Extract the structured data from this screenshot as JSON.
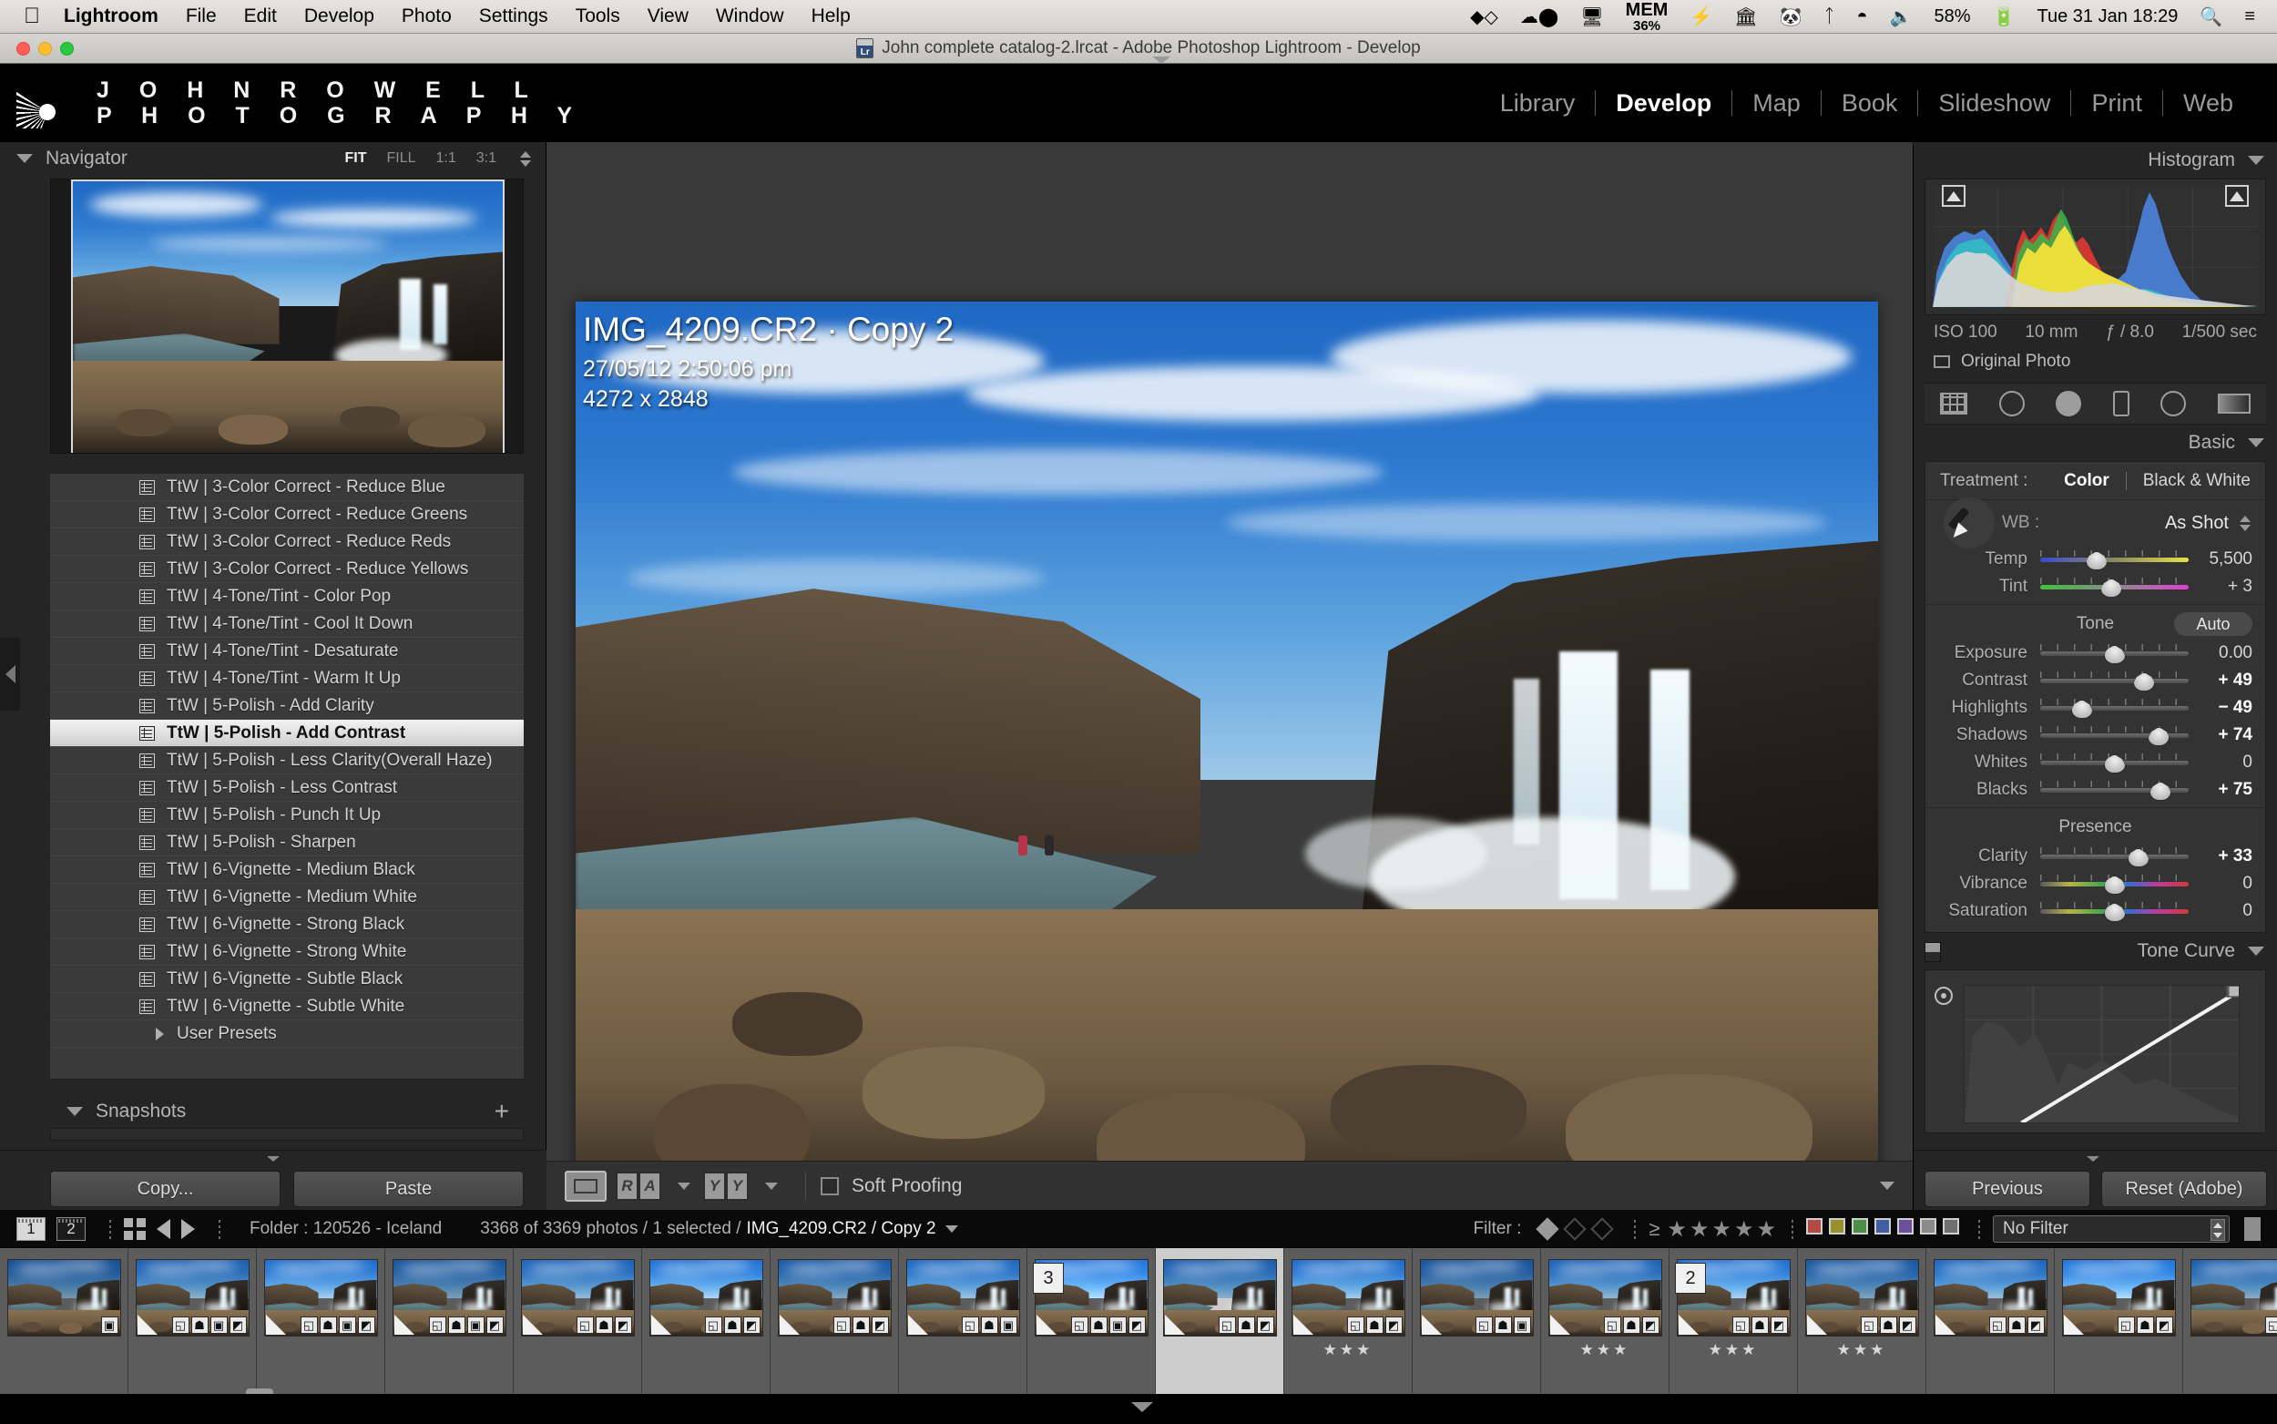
{
  "menubar": {
    "apple_icon": "apple-logo",
    "items": [
      "Lightroom",
      "File",
      "Edit",
      "Develop",
      "Photo",
      "Settings",
      "Tools",
      "View",
      "Window",
      "Help"
    ],
    "status_icons": [
      "dropbox-icon",
      "cloud-record-icon",
      "airplay-icon"
    ],
    "memory_label": "MEM",
    "memory_value": "36%",
    "more_icons": [
      "bolt-icon",
      "bank-icon",
      "evernote-icon",
      "bluetooth-icon",
      "wifi-icon",
      "volume-icon"
    ],
    "battery_percent": "58%",
    "clock": "Tue 31 Jan  18:29",
    "search_icon": "search-icon",
    "notification_icon": "notification-list-icon"
  },
  "titlebar": {
    "title": "John complete catalog-2.lrcat - Adobe Photoshop Lightroom - Develop",
    "app_badge": "Lr"
  },
  "identity": {
    "line1": "J O H N   R O W E L L",
    "line2": "P H O T O G R A P H Y",
    "logo_icon": "sunburst-logo-icon"
  },
  "modules": {
    "items": [
      "Library",
      "Develop",
      "Map",
      "Book",
      "Slideshow",
      "Print",
      "Web"
    ],
    "active": "Develop"
  },
  "left_panel": {
    "navigator": {
      "title": "Navigator",
      "zoom_options": [
        "FIT",
        "FILL",
        "1:1",
        "3:1"
      ],
      "active_zoom": "FIT"
    },
    "presets": [
      {
        "label": "TtW | 3-Color Correct - Reduce Blue",
        "selected": false
      },
      {
        "label": "TtW | 3-Color Correct - Reduce Greens",
        "selected": false
      },
      {
        "label": "TtW | 3-Color Correct - Reduce Reds",
        "selected": false
      },
      {
        "label": "TtW | 3-Color Correct - Reduce Yellows",
        "selected": false
      },
      {
        "label": "TtW | 4-Tone/Tint - Color Pop",
        "selected": false
      },
      {
        "label": "TtW | 4-Tone/Tint - Cool It Down",
        "selected": false
      },
      {
        "label": "TtW | 4-Tone/Tint - Desaturate",
        "selected": false
      },
      {
        "label": "TtW | 4-Tone/Tint - Warm It Up",
        "selected": false
      },
      {
        "label": "TtW | 5-Polish - Add Clarity",
        "selected": false
      },
      {
        "label": "TtW | 5-Polish - Add Contrast",
        "selected": true
      },
      {
        "label": "TtW | 5-Polish - Less Clarity(Overall Haze)",
        "selected": false
      },
      {
        "label": "TtW | 5-Polish - Less Contrast",
        "selected": false
      },
      {
        "label": "TtW | 5-Polish - Punch It Up",
        "selected": false
      },
      {
        "label": "TtW | 5-Polish - Sharpen",
        "selected": false
      },
      {
        "label": "TtW | 6-Vignette - Medium Black",
        "selected": false
      },
      {
        "label": "TtW | 6-Vignette - Medium White",
        "selected": false
      },
      {
        "label": "TtW | 6-Vignette - Strong Black",
        "selected": false
      },
      {
        "label": "TtW | 6-Vignette - Strong White",
        "selected": false
      },
      {
        "label": "TtW | 6-Vignette - Subtle Black",
        "selected": false
      },
      {
        "label": "TtW | 6-Vignette - Subtle White",
        "selected": false
      }
    ],
    "user_presets_label": "User Presets",
    "snapshots": {
      "title": "Snapshots",
      "add_icon": "plus-icon"
    },
    "copy_label": "Copy...",
    "paste_label": "Paste"
  },
  "center": {
    "photo_title": "IMG_4209.CR2  ·  Copy 2",
    "photo_date": "27/05/12 2:50:06 pm",
    "photo_dimensions": "4272 x 2848",
    "toolbar": {
      "loupe_icon": "loupe-view-icon",
      "before_after_labels": [
        "R",
        "A"
      ],
      "compare_labels": [
        "Y",
        "Y"
      ],
      "soft_proofing_label": "Soft Proofing",
      "soft_proofing_checked": false
    }
  },
  "right_panel": {
    "histogram": {
      "title": "Histogram",
      "iso": "ISO 100",
      "focal_length": "10 mm",
      "aperture": "ƒ / 8.0",
      "shutter": "1/500 sec",
      "original_photo_label": "Original Photo",
      "shadow_clip_icon": "shadow-clipping-icon",
      "highlight_clip_icon": "highlight-clipping-icon"
    },
    "tool_strip": [
      "crop-tool-icon",
      "spot-removal-icon",
      "red-eye-icon",
      "graduated-filter-icon",
      "radial-filter-icon",
      "adjustment-brush-icon"
    ],
    "basic": {
      "title": "Basic",
      "treatment_label": "Treatment :",
      "treatment_color": "Color",
      "treatment_bw": "Black & White",
      "wb_label": "WB :",
      "wb_value": "As Shot",
      "dropper_icon": "eyedropper-icon",
      "wb_sliders": [
        {
          "name": "Temp",
          "value": "5,500",
          "pos": 38
        },
        {
          "name": "Tint",
          "value": "+ 3",
          "pos": 48
        }
      ],
      "tone_label": "Tone",
      "auto_label": "Auto",
      "tone_sliders": [
        {
          "name": "Exposure",
          "value": "0.00",
          "pos": 50,
          "bold": false
        },
        {
          "name": "Contrast",
          "value": "+ 49",
          "pos": 70,
          "bold": true
        },
        {
          "name": "Highlights",
          "value": "− 49",
          "pos": 28,
          "bold": true
        },
        {
          "name": "Shadows",
          "value": "+ 74",
          "pos": 80,
          "bold": true
        },
        {
          "name": "Whites",
          "value": "0",
          "pos": 50,
          "bold": false
        },
        {
          "name": "Blacks",
          "value": "+ 75",
          "pos": 81,
          "bold": true
        }
      ],
      "presence_label": "Presence",
      "presence_sliders": [
        {
          "name": "Clarity",
          "value": "+ 33",
          "pos": 66,
          "bold": true
        },
        {
          "name": "Vibrance",
          "value": "0",
          "pos": 50,
          "bold": false
        },
        {
          "name": "Saturation",
          "value": "0",
          "pos": 50,
          "bold": false
        }
      ]
    },
    "tone_curve": {
      "title": "Tone Curve",
      "target_icon": "target-adjust-icon"
    },
    "previous_label": "Previous",
    "reset_label": "Reset (Adobe)"
  },
  "statusbar": {
    "screen_ids": [
      "1",
      "2"
    ],
    "grid_icon": "grid-view-icon",
    "prev_icon": "arrow-left-icon",
    "next_icon": "arrow-right-icon",
    "folder_label": "Folder : 120526 - Iceland",
    "count_text": "3368 of 3369 photos / 1 selected /",
    "current_photo": "IMG_4209.CR2 / Copy 2",
    "filter_label": "Filter :",
    "rating_prefix": "≥",
    "stars": 5,
    "color_swatches": [
      "#b24a42",
      "#9a8f2e",
      "#4a8f43",
      "#3f5fa0",
      "#6a4f9a",
      "#8a8a8a",
      "#6f6f6f"
    ],
    "filter_select_value": "No Filter"
  },
  "filmstrip": {
    "cells": [
      {
        "num": "",
        "stars": "",
        "selected": false,
        "badges": [
          "stack-icon"
        ]
      },
      {
        "num": "",
        "stars": "",
        "selected": false,
        "badges": [
          "crop-icon",
          "pin-icon",
          "stack-icon",
          "adjust-icon"
        ]
      },
      {
        "num": "",
        "stars": "",
        "selected": false,
        "badges": [
          "crop-icon",
          "pin-icon",
          "stack-icon",
          "adjust-icon"
        ]
      },
      {
        "num": "",
        "stars": "",
        "selected": false,
        "badges": [
          "crop-icon",
          "pin-icon",
          "stack-icon",
          "adjust-icon"
        ]
      },
      {
        "num": "",
        "stars": "",
        "selected": false,
        "badges": [
          "crop-icon",
          "pin-icon",
          "adjust-icon"
        ]
      },
      {
        "num": "",
        "stars": "",
        "selected": false,
        "badges": [
          "crop-icon",
          "pin-icon",
          "adjust-icon"
        ]
      },
      {
        "num": "",
        "stars": "",
        "selected": false,
        "badges": [
          "crop-icon",
          "pin-icon",
          "adjust-icon"
        ]
      },
      {
        "num": "",
        "stars": "",
        "selected": false,
        "badges": [
          "crop-icon",
          "pin-icon",
          "stack-icon"
        ]
      },
      {
        "num": "3",
        "stars": "",
        "selected": false,
        "badges": [
          "crop-icon",
          "pin-icon",
          "stack-icon",
          "adjust-icon"
        ]
      },
      {
        "num": "",
        "stars": "",
        "selected": true,
        "badges": [
          "crop-icon",
          "pin-icon",
          "adjust-icon"
        ]
      },
      {
        "num": "",
        "stars": "★★★",
        "selected": false,
        "badges": [
          "crop-icon",
          "pin-icon",
          "adjust-icon"
        ]
      },
      {
        "num": "",
        "stars": "",
        "selected": false,
        "badges": [
          "crop-icon",
          "pin-icon",
          "stack-icon"
        ]
      },
      {
        "num": "",
        "stars": "★★★",
        "selected": false,
        "badges": [
          "crop-icon",
          "pin-icon",
          "adjust-icon"
        ]
      },
      {
        "num": "2",
        "stars": "★★★",
        "selected": false,
        "badges": [
          "crop-icon",
          "pin-icon",
          "adjust-icon"
        ]
      },
      {
        "num": "",
        "stars": "★★★",
        "selected": false,
        "badges": [
          "crop-icon",
          "pin-icon",
          "adjust-icon"
        ]
      },
      {
        "num": "",
        "stars": "",
        "selected": false,
        "badges": [
          "crop-icon",
          "pin-icon",
          "adjust-icon"
        ]
      },
      {
        "num": "",
        "stars": "",
        "selected": false,
        "badges": [
          "crop-icon",
          "pin-icon",
          "adjust-icon"
        ]
      },
      {
        "num": "",
        "stars": "",
        "selected": false,
        "badges": [
          "crop-icon",
          "pin-icon"
        ]
      }
    ]
  },
  "colors": {
    "panel_bg": "#252525",
    "canvas_bg": "#3a3a3a",
    "selected_preset_bg": "#dedede",
    "accent_text": "#ffffff"
  }
}
